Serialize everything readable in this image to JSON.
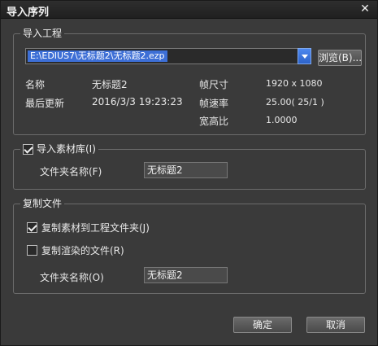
{
  "window": {
    "title": "导入序列",
    "close_glyph": "✕"
  },
  "import_project": {
    "legend": "导入工程",
    "path_value": "E:\\EDIUS7\\无标题2\\无标题2.ezp",
    "browse_label": "浏览(B)...",
    "info": {
      "name_label": "名称",
      "name_value": "无标题2",
      "updated_label": "最后更新",
      "updated_value": "2016/3/3 19:23:23",
      "frame_size_label": "帧尺寸",
      "frame_size_value": "1920 x 1080",
      "frame_rate_label": "帧速率",
      "frame_rate_value": "25.00( 25/1 )",
      "aspect_label": "宽高比",
      "aspect_value": "1.0000"
    }
  },
  "import_bin": {
    "legend": "导入素材库(I)",
    "checked": true,
    "folder_label": "文件夹名称(F)",
    "folder_value": "无标题2"
  },
  "copy_files": {
    "legend": "复制文件",
    "copy_clips_label": "复制素材到工程文件夹(J)",
    "copy_clips_checked": true,
    "copy_rendered_label": "复制渲染的文件(R)",
    "copy_rendered_checked": false,
    "folder_label": "文件夹名称(O)",
    "folder_value": "无标题2"
  },
  "footer": {
    "ok_label": "确定",
    "cancel_label": "取消"
  }
}
